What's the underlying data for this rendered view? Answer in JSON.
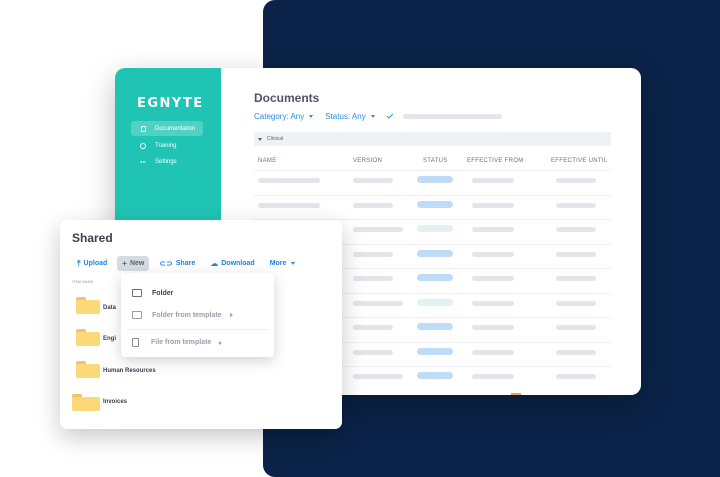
{
  "brand": {
    "logo": "EGNYTE",
    "accent": "#20c4b4",
    "navy": "#0b2348",
    "link_blue": "#2a8de0"
  },
  "sidebar": {
    "items": [
      {
        "label": "Documentation",
        "icon": "document-icon",
        "active": true
      },
      {
        "label": "Training",
        "icon": "info-icon",
        "active": false
      },
      {
        "label": "Settings",
        "icon": "more-dots-icon",
        "active": false
      }
    ]
  },
  "documents": {
    "title": "Documents",
    "filters": {
      "category": "Category: Any",
      "status": "Status: Any"
    },
    "group": "Clinical",
    "columns": [
      "NAME",
      "VERSION",
      "STATUS",
      "EFFECTIVE FROM",
      "EFFECTIVE UNTIL"
    ],
    "status_colors": {
      "blue": "#bfdcf7",
      "light": "#e4f1f3"
    }
  },
  "shared": {
    "title": "Shared",
    "toolbar": {
      "upload": "Upload",
      "new": "New",
      "share": "Share",
      "download": "Download",
      "more": "More"
    },
    "item_header": "ITEM NAME",
    "items": [
      "Data",
      "Engi",
      "Human Resources",
      "Invoices"
    ]
  },
  "new_menu": {
    "folder": "Folder",
    "folder_from_template": "Folder from template",
    "file_from_template": "File from template"
  }
}
